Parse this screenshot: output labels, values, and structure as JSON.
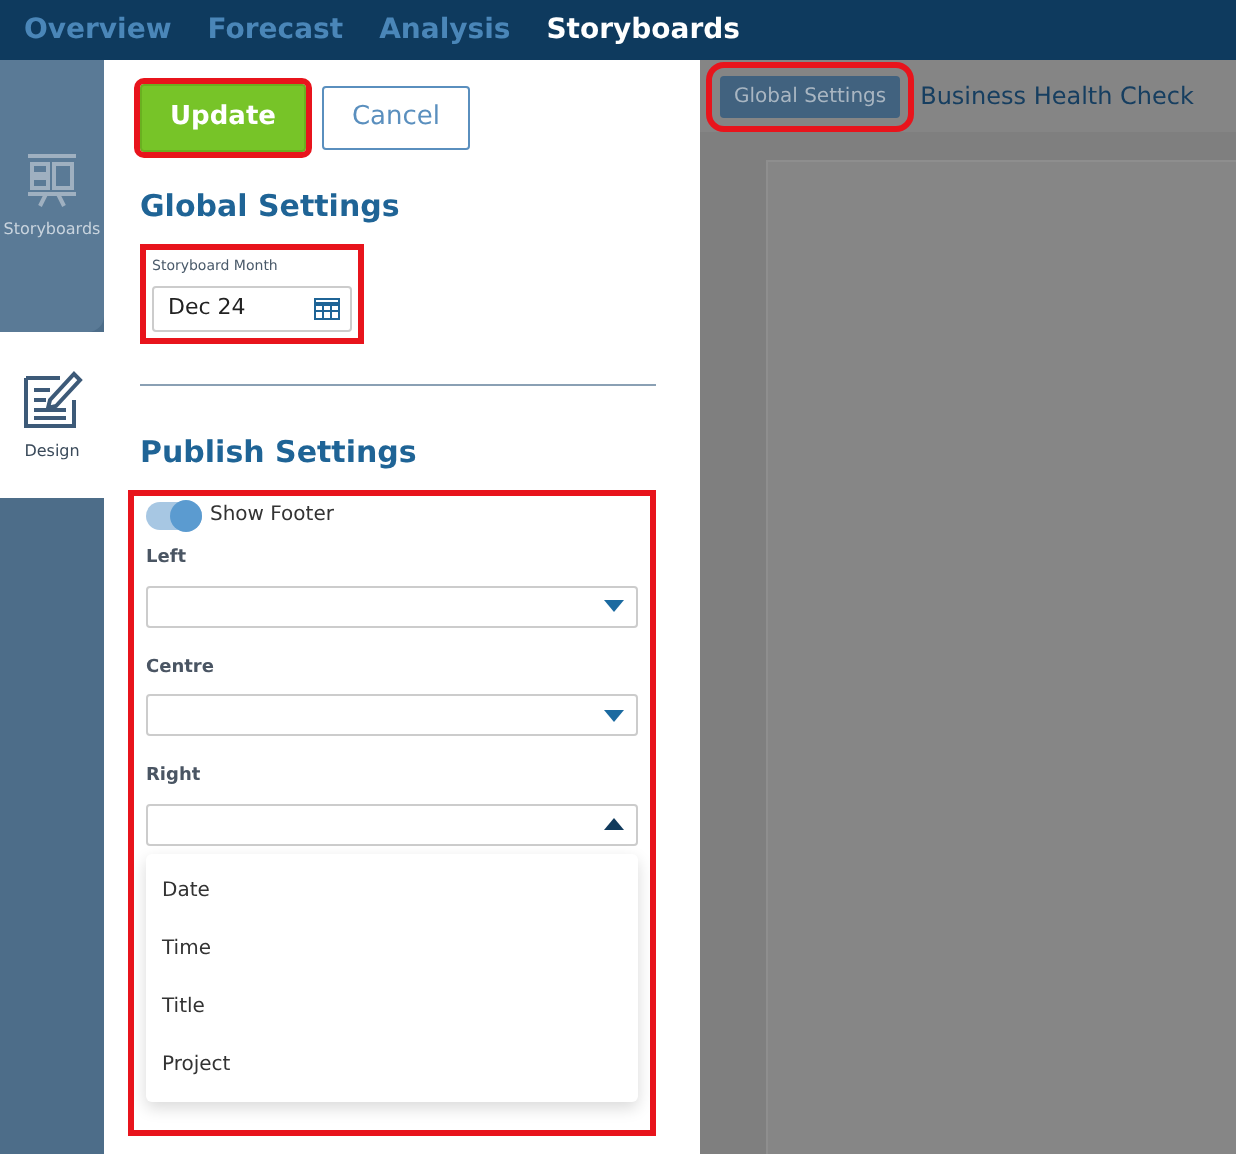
{
  "nav": [
    {
      "label": "Overview",
      "selected": false
    },
    {
      "label": "Forecast",
      "selected": false
    },
    {
      "label": "Analysis",
      "selected": false
    },
    {
      "label": "Storyboards",
      "selected": true
    }
  ],
  "rail": [
    {
      "label": "Storyboards",
      "kind": "storyboard",
      "selected": false
    },
    {
      "label": "Design",
      "kind": "design",
      "selected": true
    }
  ],
  "actions": {
    "highlighted": true,
    "buttons": [
      {
        "label": "Update",
        "kind": "primary"
      },
      {
        "label": "Cancel",
        "kind": "secondary"
      }
    ]
  },
  "global_settings": {
    "title": "Global Settings",
    "highlighted": true,
    "month_label": "Storyboard Month",
    "month_value": "Dec 24"
  },
  "publish_settings": {
    "title": "Publish Settings",
    "highlighted": true,
    "show_footer": {
      "label": "Show Footer",
      "on": true
    },
    "selects": [
      {
        "label": "Left",
        "expanded": false
      },
      {
        "label": "Centre",
        "expanded": false
      },
      {
        "label": "Right",
        "expanded": true
      }
    ],
    "options": [
      "Date",
      "Time",
      "Title",
      "Project"
    ]
  },
  "preview": {
    "tab": "Global Settings",
    "tab_highlighted": true,
    "title": "Business Health Check"
  }
}
